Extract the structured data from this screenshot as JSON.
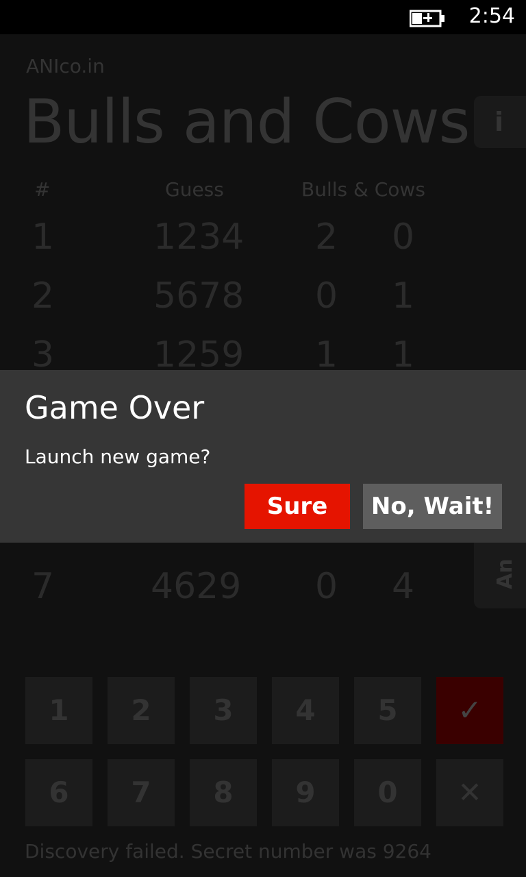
{
  "status_bar": {
    "time": "2:54",
    "battery_icon": "battery-charging-icon"
  },
  "app": {
    "publisher": "ANIco.in",
    "title": "Bulls and Cows",
    "info_label": "i",
    "side_tab_label": "An"
  },
  "table": {
    "headers": [
      "#",
      "Guess",
      "Bulls & Cows"
    ],
    "rows": [
      {
        "n": "1",
        "guess": "1234",
        "bulls": "2",
        "cows": "0"
      },
      {
        "n": "2",
        "guess": "5678",
        "bulls": "0",
        "cows": "1"
      },
      {
        "n": "3",
        "guess": "1259",
        "bulls": "1",
        "cows": "1"
      },
      {
        "n": "7",
        "guess": "4629",
        "bulls": "0",
        "cows": "4"
      }
    ]
  },
  "keypad": {
    "row1": [
      "1",
      "2",
      "3",
      "4",
      "5",
      "✓"
    ],
    "row2": [
      "6",
      "7",
      "8",
      "9",
      "0",
      "✕"
    ]
  },
  "status_message": "Discovery failed. Secret number was 9264",
  "dialog": {
    "title": "Game Over",
    "message": "Launch new game?",
    "confirm_label": "Sure",
    "cancel_label": "No, Wait!"
  },
  "colors": {
    "accent": "#e51400",
    "dialog_bg": "#363636",
    "secondary_button": "#5e5e5e"
  }
}
